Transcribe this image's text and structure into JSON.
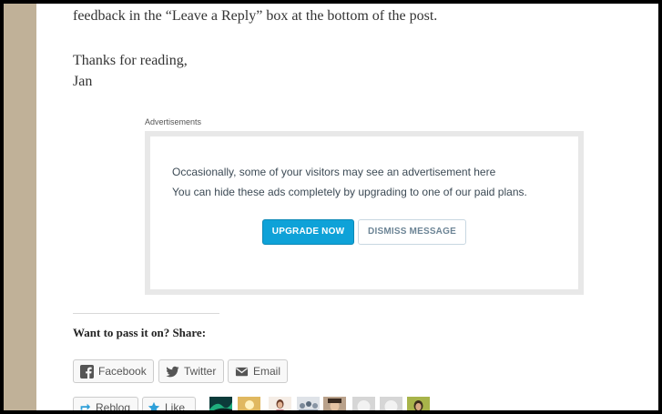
{
  "post": {
    "line1": "feedback in the “Leave a Reply” box at the bottom of the post.",
    "thanks": "Thanks for reading,",
    "signature": "Jan"
  },
  "ad": {
    "label": "Advertisements",
    "line1": "Occasionally, some of your visitors may see an advertisement here",
    "line2": "You can hide these ads completely by upgrading to one of our paid plans.",
    "upgrade_label": "UPGRADE NOW",
    "dismiss_label": "DISMISS MESSAGE",
    "upgrade_color": "#0ea2d8"
  },
  "share": {
    "heading": "Want to pass it on? Share:",
    "buttons": [
      {
        "label": "Facebook",
        "icon": "facebook-icon"
      },
      {
        "label": "Twitter",
        "icon": "twitter-icon"
      },
      {
        "label": "Email",
        "icon": "email-icon"
      }
    ]
  },
  "like": {
    "reblog_label": "Reblog",
    "like_label": "Like",
    "avatars": [
      "aurora-avatar",
      "landscape-avatar",
      "woman-avatar",
      "group-avatar",
      "face-avatar",
      "default-avatar",
      "default-avatar",
      "portrait-avatar"
    ]
  },
  "colors": {
    "sidebar": "#c0b198",
    "text": "#333333"
  }
}
